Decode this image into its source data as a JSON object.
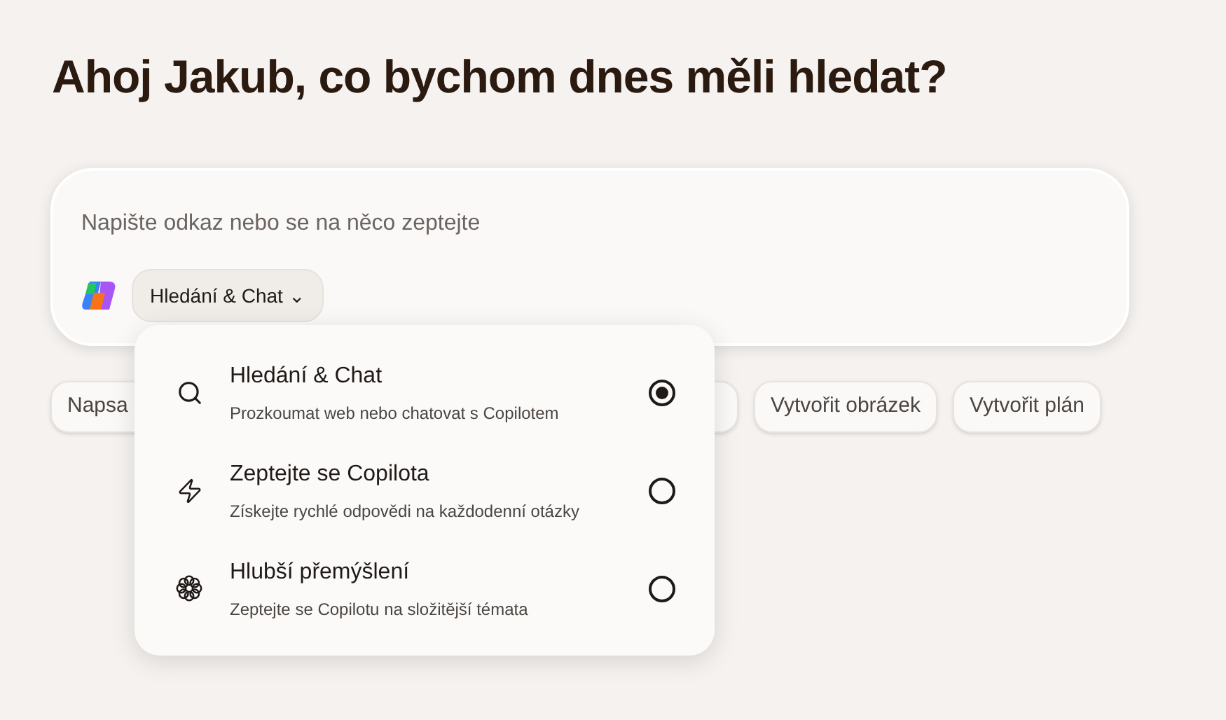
{
  "heading": "Ahoj Jakub, co bychom dnes měli hledat?",
  "composer": {
    "placeholder": "Napište odkaz nebo se na něco zeptejte",
    "mode_button": "Hledání & Chat ⌄",
    "menu_open": true
  },
  "chips": [
    {
      "kind": "text",
      "label": "Napsa"
    },
    {
      "kind": "blank"
    },
    {
      "kind": "text",
      "label": "Vytvořit obrázek"
    },
    {
      "kind": "text",
      "label": "Vytvořit plán"
    }
  ],
  "mode_menu": [
    {
      "kind": "search",
      "title": "Hledání & Chat",
      "description": "Prozkoumat web nebo chatovat s Copilotem",
      "selected": true
    },
    {
      "kind": "quick",
      "title": "Zeptejte se Copilota",
      "description": "Získejte rychlé odpovědi na každodenní otázky",
      "selected": false
    },
    {
      "kind": "deep",
      "title": "Hlubší přemýšlení",
      "description": "Zeptejte se Copilotu na složitější témata",
      "selected": false
    }
  ]
}
